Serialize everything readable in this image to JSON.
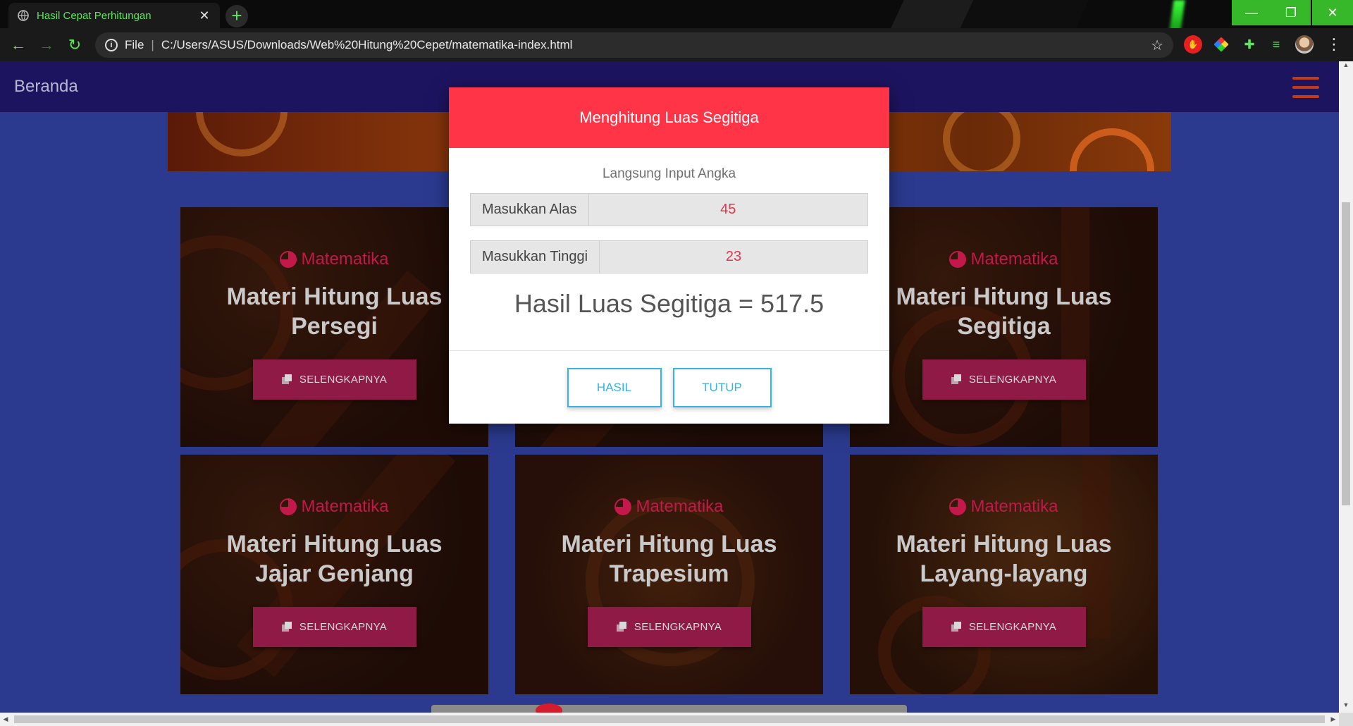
{
  "browser": {
    "tab_title": "Hasil Cepat Perhitungan",
    "url_scheme": "File",
    "url": "C:/Users/ASUS/Downloads/Web%20Hitung%20Cepet/matematika-index.html"
  },
  "navbar": {
    "brand": "Beranda"
  },
  "cards": [
    {
      "category": "Matematika",
      "title": "Materi Hitung Luas Persegi",
      "button": "SELENGKAPNYA"
    },
    {
      "category": "Matematika",
      "title": "Materi Hitung Luas Segitiga",
      "button": "SELENGKAPNYA"
    },
    {
      "category": "Matematika",
      "title": "Materi Hitung Luas Jajar Genjang",
      "button": "SELENGKAPNYA"
    },
    {
      "category": "Matematika",
      "title": "Materi Hitung Luas Trapesium",
      "button": "SELENGKAPNYA"
    },
    {
      "category": "Matematika",
      "title": "Materi Hitung Luas Layang-layang",
      "button": "SELENGKAPNYA"
    }
  ],
  "modal": {
    "title": "Menghitung Luas Segitiga",
    "hint": "Langsung Input Angka",
    "fields": [
      {
        "label": "Masukkan Alas",
        "value": "45"
      },
      {
        "label": "Masukkan Tinggi",
        "value": "23"
      }
    ],
    "result": "Hasil Luas Segitiga = 517.5",
    "buttons": {
      "hasil": "HASIL",
      "tutup": "TUTUP"
    }
  },
  "colors": {
    "modal_header": "#ff3547",
    "accent_outline": "#33b5e5",
    "card_button": "#8e1a45",
    "category": "#c2184a",
    "navbar": "#1d1460",
    "page_bg": "#2b3a8f"
  },
  "icons": {
    "tab_favicon": "globe-icon",
    "card_category": "pie-chart-icon",
    "card_button": "copy-icon",
    "navbar_menu": "hamburger-icon"
  }
}
